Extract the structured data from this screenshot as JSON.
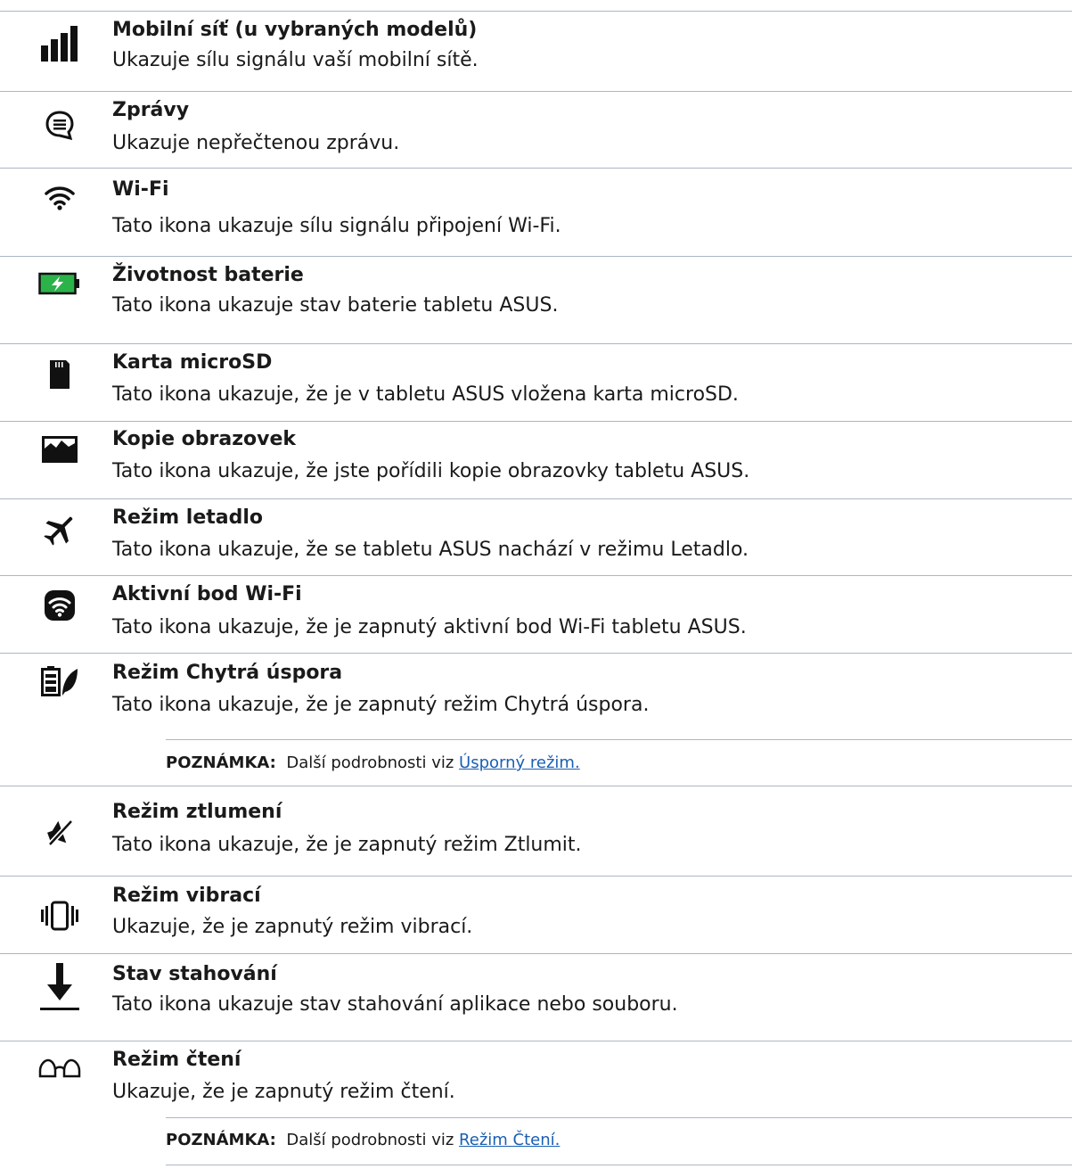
{
  "items": [
    {
      "icon": "mobile-signal-icon",
      "title": "Mobilní síť (u vybraných modelů)",
      "desc": "Ukazuje sílu signálu vaší mobilní sítě."
    },
    {
      "icon": "message-icon",
      "title": "Zprávy",
      "desc": "Ukazuje nepřečtenou zprávu."
    },
    {
      "icon": "wifi-icon",
      "title": "Wi-Fi",
      "desc": "Tato ikona ukazuje sílu signálu připojení Wi-Fi."
    },
    {
      "icon": "battery-icon",
      "title": "Životnost baterie",
      "desc": "Tato ikona ukazuje stav baterie tabletu ASUS."
    },
    {
      "icon": "microsd-icon",
      "title": "Karta microSD",
      "desc": "Tato ikona ukazuje, že je v tabletu ASUS vložena karta microSD."
    },
    {
      "icon": "screenshot-icon",
      "title": "Kopie obrazovek",
      "desc": "Tato ikona ukazuje, že jste pořídili kopie obrazovky tabletu ASUS."
    },
    {
      "icon": "airplane-icon",
      "title": "Režim letadlo",
      "desc": "Tato ikona ukazuje, že se tabletu ASUS nachází v režimu Letadlo."
    },
    {
      "icon": "hotspot-icon",
      "title": "Aktivní bod Wi-Fi",
      "desc": "Tato ikona ukazuje, že je zapnutý aktivní bod Wi-Fi tabletu ASUS."
    },
    {
      "icon": "smart-saving-icon",
      "title": "Režim Chytrá úspora",
      "desc": "Tato ikona ukazuje, že je zapnutý režim Chytrá úspora."
    },
    {
      "icon": "mute-icon",
      "title": "Režim ztlumení",
      "desc": "Tato ikona ukazuje, že je zapnutý režim Ztlumit."
    },
    {
      "icon": "vibrate-icon",
      "title": "Režim vibrací",
      "desc": "Ukazuje, že je zapnutý režim vibrací."
    },
    {
      "icon": "download-icon",
      "title": "Stav stahování",
      "desc": "Tato ikona ukazuje stav stahování aplikace nebo souboru."
    },
    {
      "icon": "reading-glasses-icon",
      "title": "Režim čtení",
      "desc": "Ukazuje, že je zapnutý režim čtení."
    }
  ],
  "notes": [
    {
      "label": "POZNÁMKA:",
      "text": "Další podrobnosti viz",
      "link": "Úsporný režim."
    },
    {
      "label": "POZNÁMKA:",
      "text": "Další podrobnosti viz",
      "link": "Režim Čtení."
    }
  ]
}
